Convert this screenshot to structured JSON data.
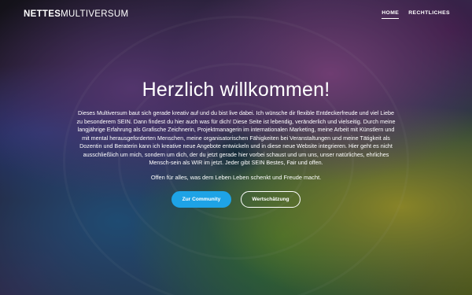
{
  "header": {
    "brand_bold": "NETTES",
    "brand_light": "MULTIVERSUM",
    "nav": [
      {
        "label": "HOME",
        "active": true
      },
      {
        "label": "RECHTLICHES",
        "active": false
      }
    ]
  },
  "hero": {
    "title": "Herzlich willkommen!",
    "intro": "Dieses Multiversum baut sich gerade kreativ auf und du bist live dabei. Ich wünsche dir flexible Entdeckerfreude und viel Liebe zu besonderem SEIN. Dann findest du hier auch was für dich! Diese Seite ist lebendig, veränderlich und vielseitig. Durch meine langjährige Erfahrung als Grafische Zeichnerin, Projektmanagerin im internationalen Marketing, meine Arbeit mit Künstlern und mit mental herausgeforderten Menschen, meine organisatorischen Fähigkeiten bei Veranstaltungen und meine Tätigkeit als Dozentin und Beraterin kann ich kreative neue Angebote entwickeln und in diese neue Website integrieren. Hier geht es nicht ausschließlich um mich, sondern um dich, der du jetzt gerade hier vorbei schaust und um uns, unser natürliches, ehrliches Mensch-sein als WIR im jetzt. Jeder gibt SEIN Bestes, Fair und offen.",
    "tagline": "Offen für alles, was dem Leben Leben schenkt und Freude macht.",
    "primary_button": "Zur Community",
    "secondary_button": "Wertschätzung"
  },
  "colors": {
    "accent": "#1ea3e6",
    "text": "#ffffff"
  }
}
